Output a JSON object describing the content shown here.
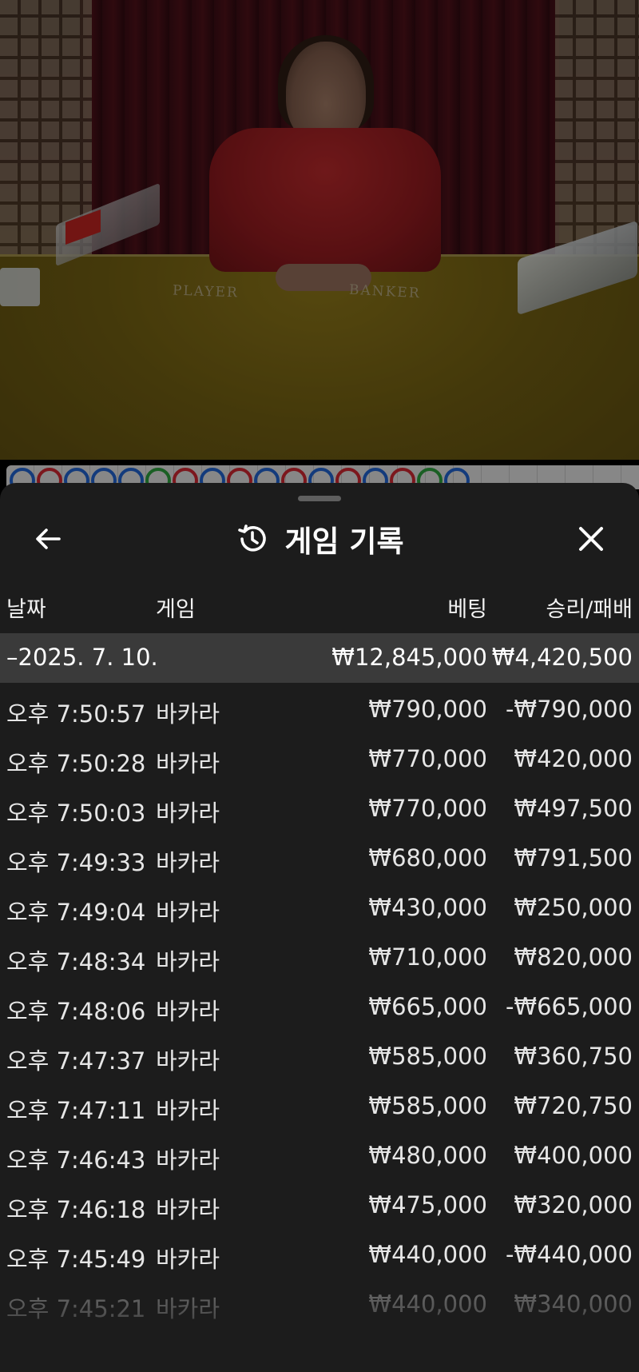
{
  "scene": {
    "table_labels": {
      "player": "PLAYER",
      "banker": "BANKER"
    },
    "road_beads": [
      "b",
      "r",
      "b",
      "b",
      "b",
      "t",
      "r",
      "b",
      "r",
      "b",
      "r",
      "b",
      "r",
      "b",
      "r",
      "t",
      "b"
    ]
  },
  "panel": {
    "title": "게임 기록",
    "icons": {
      "back": "arrow-left-icon",
      "history": "history-clock-icon",
      "close": "close-icon"
    },
    "columns": {
      "date": "날짜",
      "game": "게임",
      "bet": "베팅",
      "winloss": "승리/패배"
    },
    "summary": {
      "date": "–2025. 7. 10.",
      "bet": "₩12,845,000",
      "winloss": "₩4,420,500"
    },
    "rows": [
      {
        "time": "오후 7:50:57",
        "game": "바카라",
        "bet": "₩790,000",
        "winloss": "-₩790,000"
      },
      {
        "time": "오후 7:50:28",
        "game": "바카라",
        "bet": "₩770,000",
        "winloss": "₩420,000"
      },
      {
        "time": "오후 7:50:03",
        "game": "바카라",
        "bet": "₩770,000",
        "winloss": "₩497,500"
      },
      {
        "time": "오후 7:49:33",
        "game": "바카라",
        "bet": "₩680,000",
        "winloss": "₩791,500"
      },
      {
        "time": "오후 7:49:04",
        "game": "바카라",
        "bet": "₩430,000",
        "winloss": "₩250,000"
      },
      {
        "time": "오후 7:48:34",
        "game": "바카라",
        "bet": "₩710,000",
        "winloss": "₩820,000"
      },
      {
        "time": "오후 7:48:06",
        "game": "바카라",
        "bet": "₩665,000",
        "winloss": "-₩665,000"
      },
      {
        "time": "오후 7:47:37",
        "game": "바카라",
        "bet": "₩585,000",
        "winloss": "₩360,750"
      },
      {
        "time": "오후 7:47:11",
        "game": "바카라",
        "bet": "₩585,000",
        "winloss": "₩720,750"
      },
      {
        "time": "오후 7:46:43",
        "game": "바카라",
        "bet": "₩480,000",
        "winloss": "₩400,000"
      },
      {
        "time": "오후 7:46:18",
        "game": "바카라",
        "bet": "₩475,000",
        "winloss": "₩320,000"
      },
      {
        "time": "오후 7:45:49",
        "game": "바카라",
        "bet": "₩440,000",
        "winloss": "-₩440,000"
      },
      {
        "time": "오후 7:45:21",
        "game": "바카라",
        "bet": "₩440,000",
        "winloss": "₩340,000"
      }
    ]
  }
}
